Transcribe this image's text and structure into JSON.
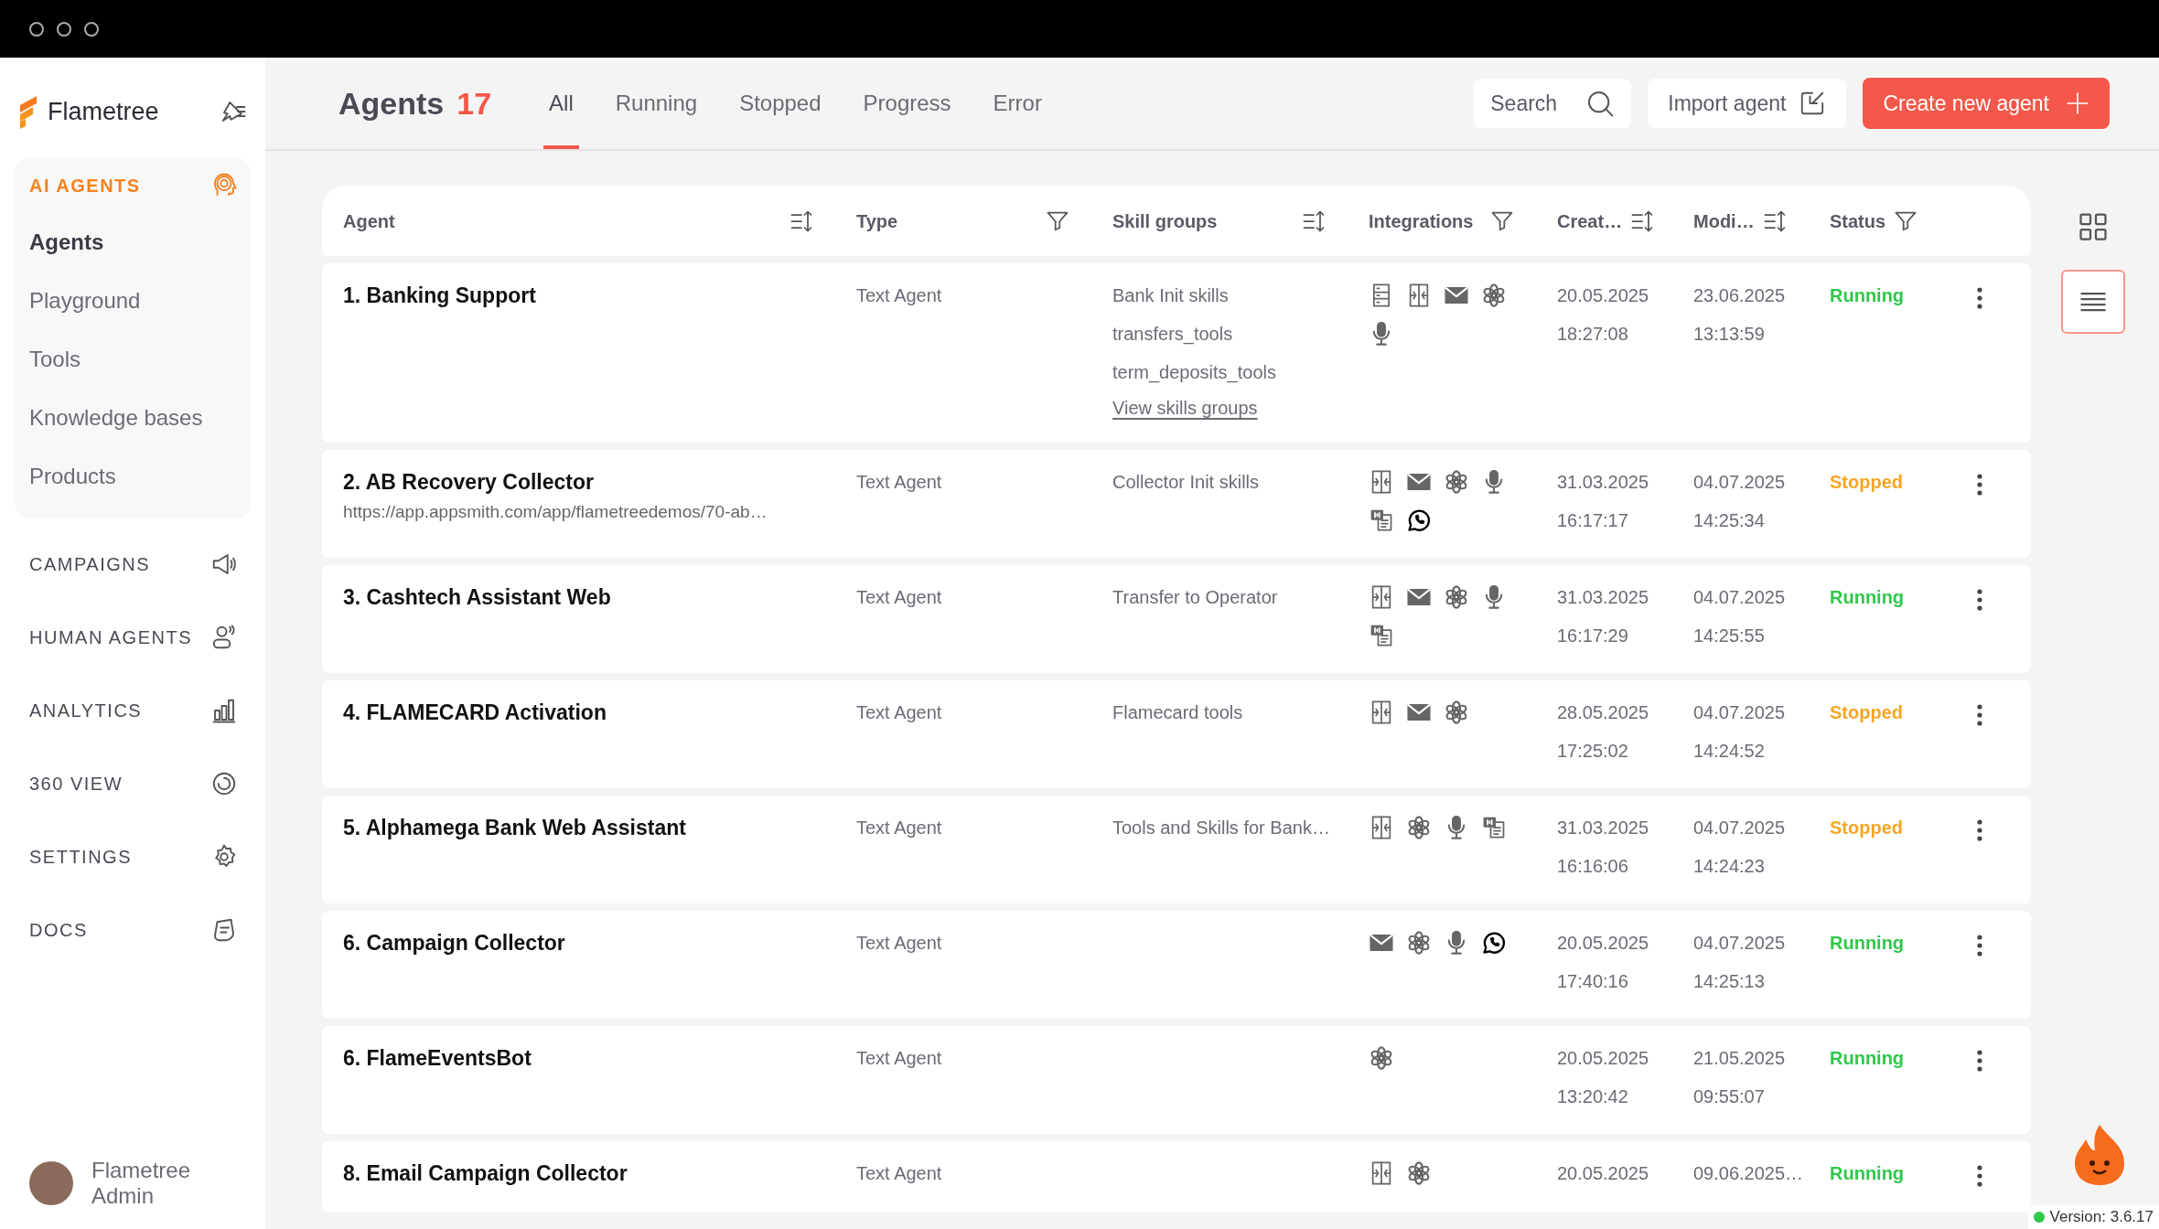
{
  "sidebar": {
    "brand": "Flametree",
    "sections": [
      {
        "label": "AI AGENTS",
        "kind": "head",
        "active": true,
        "items": [
          {
            "label": "Agents",
            "selected": true
          },
          {
            "label": "Playground",
            "selected": false
          },
          {
            "label": "Tools",
            "selected": false
          },
          {
            "label": "Knowledge bases",
            "selected": false
          },
          {
            "label": "Products",
            "selected": false
          }
        ]
      },
      {
        "label": "CAMPAIGNS",
        "kind": "megaphone",
        "active": false
      },
      {
        "label": "HUMAN AGENTS",
        "kind": "person",
        "active": false
      },
      {
        "label": "ANALYTICS",
        "kind": "bars",
        "active": false
      },
      {
        "label": "360 VIEW",
        "kind": "ring",
        "active": false
      },
      {
        "label": "SETTINGS",
        "kind": "gear",
        "active": false
      },
      {
        "label": "DOCS",
        "kind": "doc",
        "active": false
      }
    ],
    "user": {
      "name": "Flametree Admin"
    }
  },
  "header": {
    "title": "Agents",
    "count": "17",
    "tabs": [
      {
        "label": "All",
        "selected": true
      },
      {
        "label": "Running",
        "selected": false
      },
      {
        "label": "Stopped",
        "selected": false
      },
      {
        "label": "Progress",
        "selected": false
      },
      {
        "label": "Error",
        "selected": false
      }
    ],
    "search": {
      "placeholder": "Search"
    },
    "import_button": "Import agent",
    "create_button": "Create new agent"
  },
  "view_toggle": [
    {
      "kind": "grid",
      "selected": false
    },
    {
      "kind": "list",
      "selected": true
    }
  ],
  "table": {
    "columns": [
      {
        "label": "Agent",
        "kind": "sort"
      },
      {
        "label": "Type",
        "kind": "filter"
      },
      {
        "label": "Skill groups",
        "kind": "sort"
      },
      {
        "label": "Integrations",
        "kind": "filter"
      },
      {
        "label": "Creat…",
        "kind": "sort"
      },
      {
        "label": "Modi…",
        "kind": "sort"
      },
      {
        "label": "Status",
        "kind": "filter"
      }
    ],
    "rows": [
      {
        "name": "1. Banking Support",
        "type": "Text Agent",
        "skills": [
          "Bank Init skills",
          "transfers_tools",
          "term_deposits_tools"
        ],
        "skills_link": "View skills groups",
        "integrations": [
          {
            "kind": "server"
          },
          {
            "kind": "scan"
          },
          {
            "kind": "mail"
          },
          {
            "kind": "swirl"
          },
          {
            "kind": "mic"
          }
        ],
        "created_date": "20.05.2025",
        "created_time": "18:27:08",
        "modified_date": "23.06.2025",
        "modified_time": "13:13:59",
        "status": "Running",
        "color": "#2fc84a"
      },
      {
        "name": "2. AB Recovery Collector",
        "url": "https://app.appsmith.com/app/flametreedemos/70-ab…",
        "type": "Text Agent",
        "skills": [
          "Collector Init skills"
        ],
        "integrations": [
          {
            "kind": "scan"
          },
          {
            "kind": "mail"
          },
          {
            "kind": "swirl"
          },
          {
            "kind": "mic"
          },
          {
            "kind": "transcript"
          },
          {
            "kind": "chat"
          }
        ],
        "created_date": "31.03.2025",
        "created_time": "16:17:17",
        "modified_date": "04.07.2025",
        "modified_time": "14:25:34",
        "status": "Stopped",
        "color": "#f5a623"
      },
      {
        "name": "3. Cashtech Assistant Web",
        "type": "Text Agent",
        "skills": [
          "Transfer to Operator"
        ],
        "integrations": [
          {
            "kind": "scan"
          },
          {
            "kind": "mail"
          },
          {
            "kind": "swirl"
          },
          {
            "kind": "mic"
          },
          {
            "kind": "transcript"
          }
        ],
        "created_date": "31.03.2025",
        "created_time": "16:17:29",
        "modified_date": "04.07.2025",
        "modified_time": "14:25:55",
        "status": "Running",
        "color": "#2fc84a"
      },
      {
        "name": "4. FLAMECARD Activation",
        "type": "Text Agent",
        "skills": [
          "Flamecard tools"
        ],
        "integrations": [
          {
            "kind": "scan"
          },
          {
            "kind": "mail"
          },
          {
            "kind": "swirl"
          }
        ],
        "created_date": "28.05.2025",
        "created_time": "17:25:02",
        "modified_date": "04.07.2025",
        "modified_time": "14:24:52",
        "status": "Stopped",
        "color": "#f5a623"
      },
      {
        "name": "5. Alphamega Bank Web Assistant",
        "type": "Text Agent",
        "skills": [
          "Tools and Skills for Bank…"
        ],
        "integrations": [
          {
            "kind": "scan"
          },
          {
            "kind": "swirl"
          },
          {
            "kind": "mic"
          },
          {
            "kind": "transcript"
          }
        ],
        "created_date": "31.03.2025",
        "created_time": "16:16:06",
        "modified_date": "04.07.2025",
        "modified_time": "14:24:23",
        "status": "Stopped",
        "color": "#f5a623"
      },
      {
        "name": "6. Campaign Collector",
        "type": "Text Agent",
        "integrations": [
          {
            "kind": "mail"
          },
          {
            "kind": "swirl"
          },
          {
            "kind": "mic"
          },
          {
            "kind": "chat"
          }
        ],
        "created_date": "20.05.2025",
        "created_time": "17:40:16",
        "modified_date": "04.07.2025",
        "modified_time": "14:25:13",
        "status": "Running",
        "color": "#2fc84a"
      },
      {
        "name": "6. FlameEventsBot",
        "type": "Text Agent",
        "integrations": [
          {
            "kind": "swirl"
          }
        ],
        "created_date": "20.05.2025",
        "created_time": "13:20:42",
        "modified_date": "21.05.2025",
        "modified_time": "09:55:07",
        "status": "Running",
        "color": "#2fc84a"
      },
      {
        "name": "8. Email Campaign Collector",
        "type": "Text Agent",
        "integrations": [
          {
            "kind": "scan"
          },
          {
            "kind": "swirl"
          }
        ],
        "created_date": "20.05.2025",
        "modified_date": "09.06.2025…",
        "status": "Running",
        "color": "#2fc84a"
      }
    ]
  },
  "version": {
    "label": "Version: 3.6.17",
    "color": "#2fc84a"
  }
}
